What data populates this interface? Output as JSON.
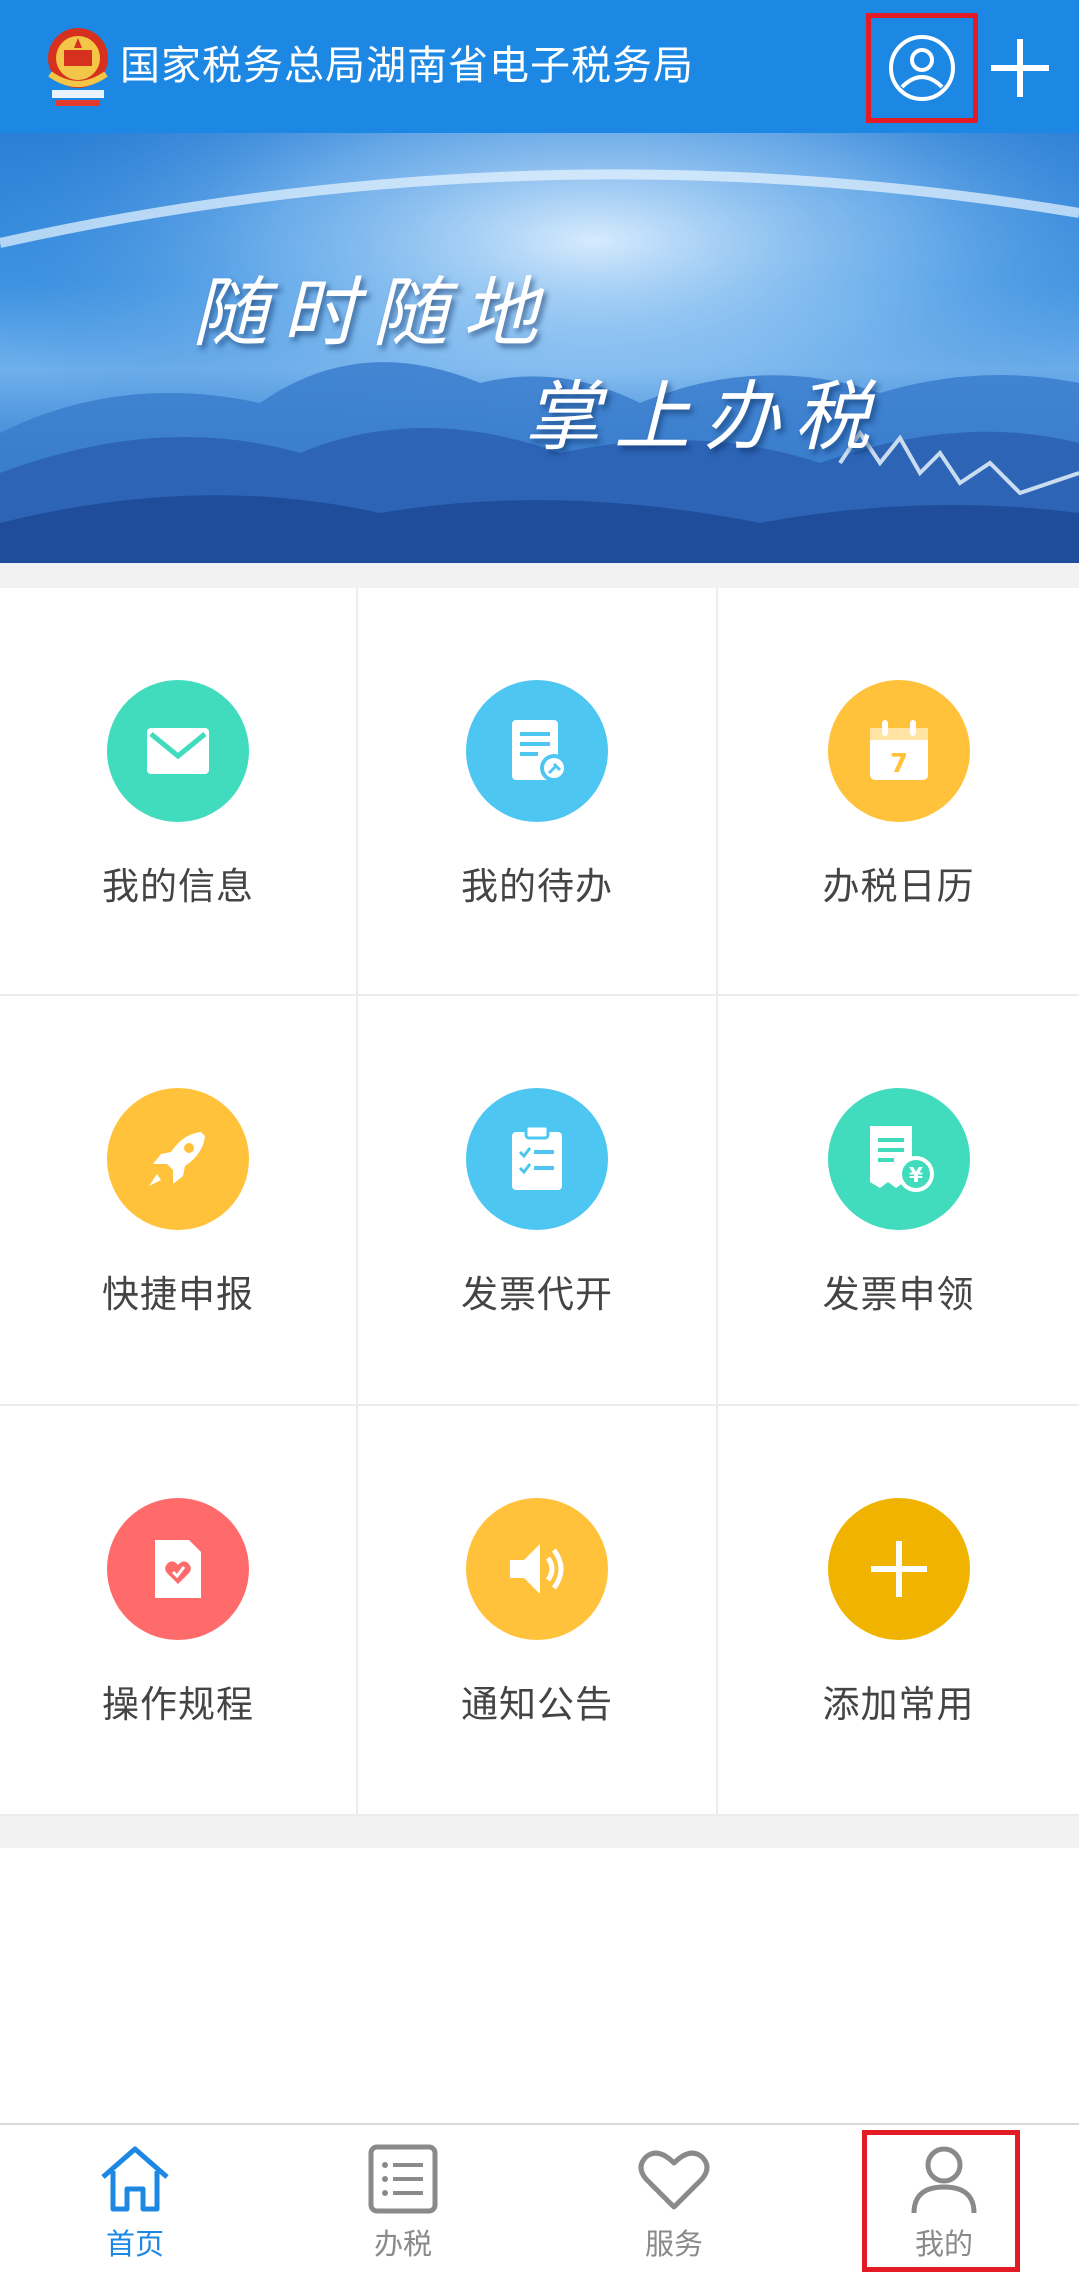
{
  "header": {
    "title": "国家税务总局湖南省电子税务局",
    "brand_color": "#1d88e3",
    "icons": {
      "emblem": "tax-emblem-icon",
      "user": "user-circle-icon",
      "add": "plus-icon"
    }
  },
  "banner": {
    "line1": "随时随地",
    "line2": "掌上办税"
  },
  "grid": {
    "items": [
      {
        "label": "我的信息",
        "icon": "envelope-icon",
        "color": "#41dbbd"
      },
      {
        "label": "我的待办",
        "icon": "document-pin-icon",
        "color": "#4dc6f2"
      },
      {
        "label": "办税日历",
        "icon": "calendar-icon",
        "color": "#ffc23a"
      },
      {
        "label": "快捷申报",
        "icon": "rocket-icon",
        "color": "#ffc23a"
      },
      {
        "label": "发票代开",
        "icon": "clipboard-list-icon",
        "color": "#4dc6f2"
      },
      {
        "label": "发票申领",
        "icon": "receipt-yen-icon",
        "color": "#41dbbd"
      },
      {
        "label": "操作规程",
        "icon": "heart-file-icon",
        "color": "#ff6b6b"
      },
      {
        "label": "通知公告",
        "icon": "speaker-icon",
        "color": "#ffc23a"
      },
      {
        "label": "添加常用",
        "icon": "plus-icon",
        "color": "#f0b400"
      }
    ]
  },
  "tabbar": {
    "active_color": "#1d88e3",
    "inactive_color": "#8a8a8a",
    "tabs": [
      {
        "label": "首页",
        "icon": "home-icon",
        "active": true
      },
      {
        "label": "办税",
        "icon": "list-icon",
        "active": false
      },
      {
        "label": "服务",
        "icon": "heart-icon",
        "active": false
      },
      {
        "label": "我的",
        "icon": "person-icon",
        "active": false
      }
    ]
  },
  "highlight_color": "#e31b25"
}
